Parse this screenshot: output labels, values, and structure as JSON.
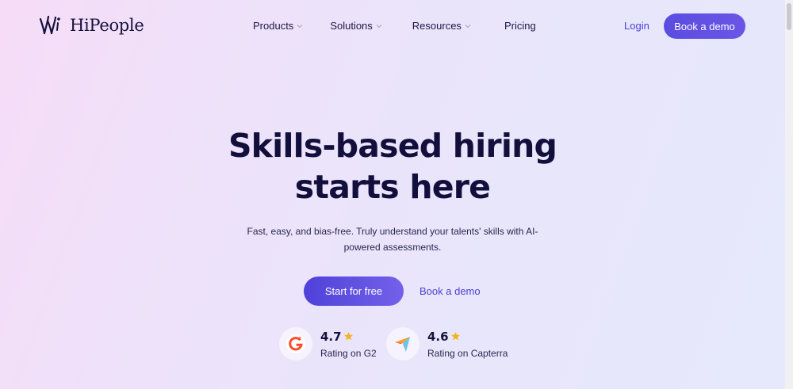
{
  "brand": {
    "name": "HiPeople",
    "logo_icon": "hipeople-logo-icon"
  },
  "nav": {
    "items": [
      {
        "label": "Products",
        "has_dropdown": true
      },
      {
        "label": "Solutions",
        "has_dropdown": true
      },
      {
        "label": "Resources",
        "has_dropdown": true
      },
      {
        "label": "Pricing",
        "has_dropdown": false
      }
    ],
    "login_label": "Login",
    "cta_label": "Book a demo"
  },
  "hero": {
    "title_line1": "Skills-based hiring",
    "title_line2": "starts here",
    "subtitle": "Fast, easy, and bias-free. Truly understand your talents' skills with AI-powered assessments.",
    "primary_cta": "Start for free",
    "secondary_cta": "Book a demo"
  },
  "ratings": [
    {
      "score": "4.7",
      "label": "Rating on G2",
      "icon": "g2-logo-icon"
    },
    {
      "score": "4.6",
      "label": "Rating on Capterra",
      "icon": "capterra-logo-icon"
    }
  ],
  "colors": {
    "accent": "#5b4de0",
    "text_dark": "#15113d",
    "link": "#4b3fd6",
    "star": "#f5b323",
    "g2_red": "#ff492c"
  }
}
